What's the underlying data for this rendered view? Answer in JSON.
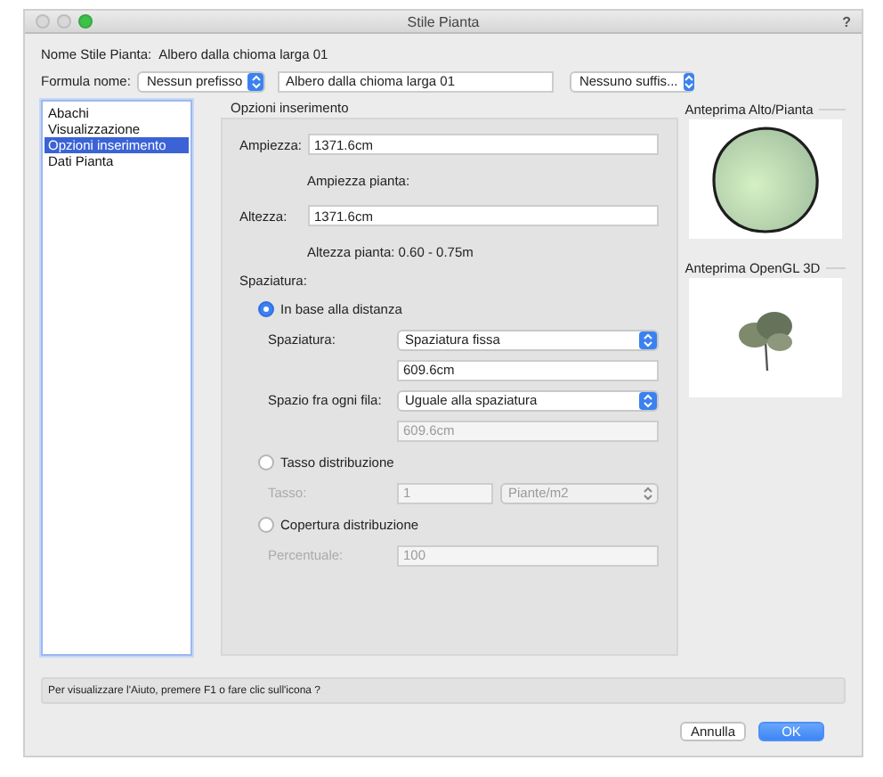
{
  "window": {
    "title": "Stile Pianta",
    "help_glyph": "?"
  },
  "name_row": {
    "label": "Nome Stile Pianta:",
    "value": "Albero dalla chioma larga 01"
  },
  "formula_row": {
    "label": "Formula nome:",
    "prefix": "Nessun prefisso",
    "name_value": "Albero dalla chioma larga 01",
    "suffix": "Nessuno suffis..."
  },
  "sidebar": {
    "items": [
      {
        "label": "Abachi",
        "selected": false
      },
      {
        "label": "Visualizzazione",
        "selected": false
      },
      {
        "label": "Opzioni inserimento",
        "selected": true
      },
      {
        "label": "Dati Pianta",
        "selected": false
      }
    ]
  },
  "panel": {
    "title": "Opzioni inserimento",
    "rows": [
      {
        "kind": "field",
        "label": "Ampiezza:",
        "value": "1371.6cm",
        "disabled": false
      },
      {
        "kind": "note",
        "text": "Ampiezza pianta:"
      },
      {
        "kind": "field",
        "label": "Altezza:",
        "value": "1371.6cm",
        "disabled": false
      },
      {
        "kind": "note",
        "text": "Altezza pianta: 0.60 - 0.75m"
      },
      {
        "kind": "heading",
        "text": "Spaziatura:"
      },
      {
        "kind": "radio",
        "label": "In base alla distanza",
        "selected": true
      },
      {
        "kind": "sub_select",
        "label": "Spaziatura:",
        "value": "Spaziatura fissa",
        "disabled": false
      },
      {
        "kind": "sub_value",
        "value": "609.6cm",
        "disabled": false
      },
      {
        "kind": "sub_select",
        "label": "Spazio fra ogni fila:",
        "value": "Uguale alla spaziatura",
        "disabled": false
      },
      {
        "kind": "sub_value",
        "value": "609.6cm",
        "disabled": true
      },
      {
        "kind": "radio",
        "label": "Tasso distribuzione",
        "selected": false
      },
      {
        "kind": "sub_pair",
        "label": "Tasso:",
        "value": "1",
        "unit": "Piante/m2",
        "disabled": true
      },
      {
        "kind": "radio",
        "label": "Copertura distribuzione",
        "selected": false
      },
      {
        "kind": "sub_field",
        "label": "Percentuale:",
        "value": "100",
        "disabled": true
      }
    ]
  },
  "previews": [
    {
      "kind": "plan",
      "title": "Anteprima Alto/Pianta"
    },
    {
      "kind": "tree3d",
      "title": "Anteprima OpenGL 3D"
    }
  ],
  "help_text": "Per visualizzare l'Aiuto, premere F1 o fare clic sull'icona ?",
  "buttons": [
    {
      "label": "Annulla",
      "primary": false
    },
    {
      "label": "OK",
      "primary": true
    }
  ]
}
